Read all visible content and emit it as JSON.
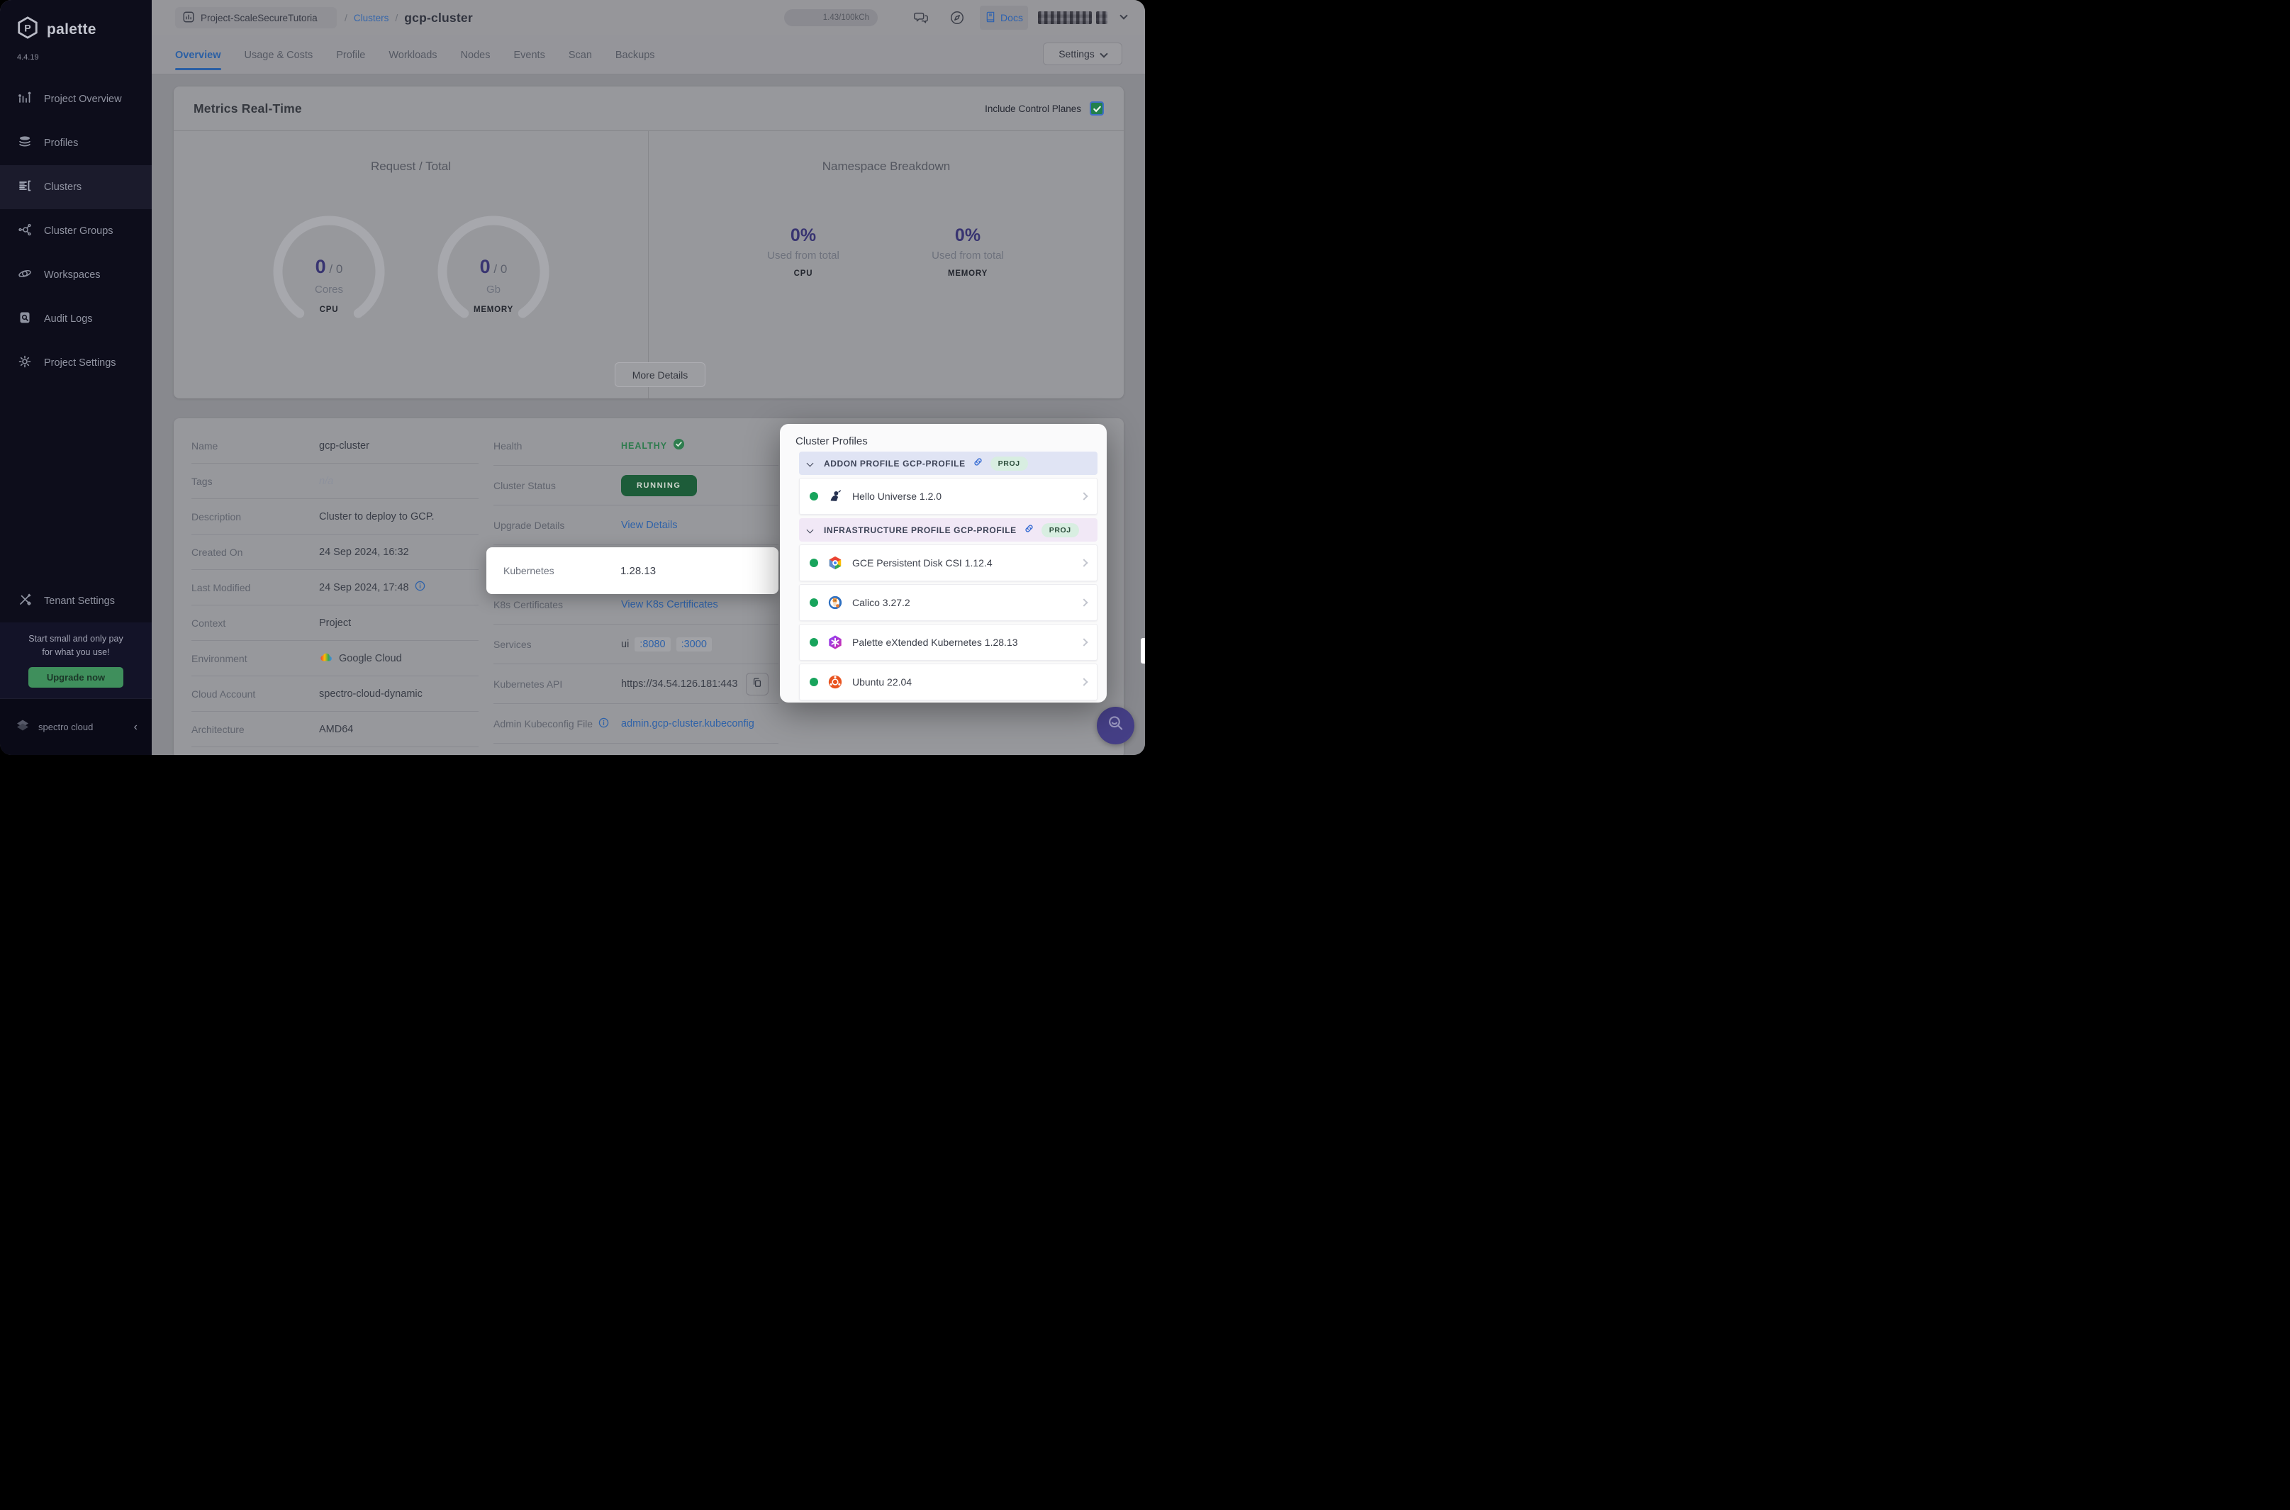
{
  "sidebar": {
    "brand": "palette",
    "version": "4.4.19",
    "items": [
      {
        "label": "Project Overview"
      },
      {
        "label": "Profiles"
      },
      {
        "label": "Clusters"
      },
      {
        "label": "Cluster Groups"
      },
      {
        "label": "Workspaces"
      },
      {
        "label": "Audit Logs"
      },
      {
        "label": "Project Settings"
      }
    ],
    "active_item": "Clusters",
    "tenant_settings": "Tenant Settings",
    "promo_line1": "Start small and only pay",
    "promo_line2": "for what you use!",
    "upgrade_button": "Upgrade now",
    "footer_brand": "spectro cloud"
  },
  "topbar": {
    "project_name": "Project-ScaleSecureTutoria",
    "breadcrumb_separator": "/",
    "breadcrumb_section": "Clusters",
    "cluster_name": "gcp-cluster",
    "credits": "1.43/100kCh",
    "docs_label": "Docs"
  },
  "tabs": {
    "items": [
      "Overview",
      "Usage & Costs",
      "Profile",
      "Workloads",
      "Nodes",
      "Events",
      "Scan",
      "Backups"
    ],
    "active": "Overview",
    "settings_button": "Settings"
  },
  "metrics": {
    "title": "Metrics Real-Time",
    "include_control_planes_label": "Include Control Planes",
    "include_control_planes_checked": true,
    "request_total": {
      "title": "Request / Total",
      "gauges": [
        {
          "value": "0",
          "separator": "/",
          "total": "0",
          "unit": "Cores",
          "caption": "CPU"
        },
        {
          "value": "0",
          "separator": "/",
          "total": "0",
          "unit": "Gb",
          "caption": "MEMORY"
        }
      ]
    },
    "namespace_breakdown": {
      "title": "Namespace Breakdown",
      "stats": [
        {
          "percent": "0%",
          "label": "Used from total",
          "caption": "CPU"
        },
        {
          "percent": "0%",
          "label": "Used from total",
          "caption": "MEMORY"
        }
      ]
    },
    "more_details_button": "More Details"
  },
  "details": {
    "left_rows": [
      {
        "label": "Name",
        "value": "gcp-cluster"
      },
      {
        "label": "Tags",
        "value": "n/a"
      },
      {
        "label": "Description",
        "value": "Cluster to deploy to GCP."
      },
      {
        "label": "Created On",
        "value": "24 Sep 2024, 16:32"
      },
      {
        "label": "Last Modified",
        "value": "24 Sep 2024, 17:48"
      },
      {
        "label": "Context",
        "value": "Project"
      },
      {
        "label": "Environment",
        "value": "Google Cloud"
      },
      {
        "label": "Cloud Account",
        "value": "spectro-cloud-dynamic"
      },
      {
        "label": "Architecture",
        "value": "AMD64"
      }
    ],
    "right_rows": {
      "health": {
        "label": "Health",
        "value": "HEALTHY"
      },
      "cluster_status": {
        "label": "Cluster Status",
        "value": "RUNNING"
      },
      "upgrade_details": {
        "label": "Upgrade Details",
        "value": "View Details"
      },
      "kubernetes": {
        "label": "Kubernetes",
        "value": "1.28.13"
      },
      "k8s_certificates": {
        "label": "K8s Certificates",
        "value": "View K8s Certificates"
      },
      "services": {
        "label": "Services",
        "value_prefix": "ui",
        "ports": [
          ":8080",
          ":3000"
        ]
      },
      "kubernetes_api": {
        "label": "Kubernetes API",
        "value": "https://34.54.126.181:443"
      },
      "admin_kubeconfig": {
        "label": "Admin Kubeconfig File",
        "value": "admin.gcp-cluster.kubeconfig"
      }
    }
  },
  "profiles_panel": {
    "title": "Cluster Profiles",
    "sections": [
      {
        "header": "ADDON PROFILE GCP-PROFILE",
        "badge": "PROJ",
        "items": [
          {
            "name": "Hello Universe 1.2.0",
            "icon": "hello-universe",
            "status": "green"
          }
        ]
      },
      {
        "header": "INFRASTRUCTURE PROFILE GCP-PROFILE",
        "badge": "PROJ",
        "items": [
          {
            "name": "GCE Persistent Disk CSI 1.12.4",
            "icon": "gce-persistent-disk",
            "status": "green"
          },
          {
            "name": "Calico 3.27.2",
            "icon": "calico",
            "status": "green"
          },
          {
            "name": "Palette eXtended Kubernetes 1.28.13",
            "icon": "palette-extended-kubernetes",
            "status": "green"
          },
          {
            "name": "Ubuntu 22.04",
            "icon": "ubuntu",
            "status": "green"
          }
        ]
      }
    ]
  },
  "colors": {
    "accent_blue": "#2f62a8",
    "running_green": "#1d5c39",
    "healthy_green": "#2f7b4e",
    "indigo_metric": "#383471",
    "upgrade_green": "#3f8f5c",
    "status_dot_green": "#18a45c"
  }
}
